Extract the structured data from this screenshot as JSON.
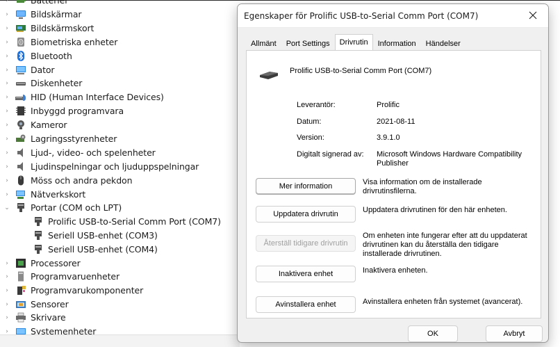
{
  "tree": {
    "items": [
      {
        "label": "Batterier",
        "icon": "battery-icon",
        "chevron": "›"
      },
      {
        "label": "Bildskärmar",
        "icon": "monitor-icon",
        "chevron": "›"
      },
      {
        "label": "Bildskärmskort",
        "icon": "display-adapter-icon",
        "chevron": "›"
      },
      {
        "label": "Biometriska enheter",
        "icon": "fingerprint-icon",
        "chevron": "›"
      },
      {
        "label": "Bluetooth",
        "icon": "bluetooth-icon",
        "chevron": "›"
      },
      {
        "label": "Dator",
        "icon": "computer-icon",
        "chevron": "›"
      },
      {
        "label": "Diskenheter",
        "icon": "disk-drive-icon",
        "chevron": "›"
      },
      {
        "label": "HID (Human Interface Devices)",
        "icon": "hid-icon",
        "chevron": "›"
      },
      {
        "label": "Inbyggd programvara",
        "icon": "firmware-icon",
        "chevron": "›"
      },
      {
        "label": "Kameror",
        "icon": "camera-icon",
        "chevron": "›"
      },
      {
        "label": "Lagringsstyrenheter",
        "icon": "storage-controller-icon",
        "chevron": "›"
      },
      {
        "label": "Ljud-, video- och spelenheter",
        "icon": "speaker-icon",
        "chevron": "›"
      },
      {
        "label": "Ljudinspelningar och ljuduppspelningar",
        "icon": "audio-io-icon",
        "chevron": "›"
      },
      {
        "label": "Möss och andra pekdon",
        "icon": "mouse-icon",
        "chevron": "›"
      },
      {
        "label": "Nätverkskort",
        "icon": "network-adapter-icon",
        "chevron": "›"
      },
      {
        "label": "Portar (COM och LPT)",
        "icon": "port-icon",
        "chevron": "⌄"
      },
      {
        "label": "Prolific USB-to-Serial Comm Port (COM7)",
        "icon": "port-icon",
        "child": true
      },
      {
        "label": "Seriell USB-enhet (COM3)",
        "icon": "port-icon",
        "child": true
      },
      {
        "label": "Seriell USB-enhet (COM4)",
        "icon": "port-icon",
        "child": true
      },
      {
        "label": "Processorer",
        "icon": "processor-icon",
        "chevron": "›"
      },
      {
        "label": "Programvaruenheter",
        "icon": "software-device-icon",
        "chevron": "›"
      },
      {
        "label": "Programvarukomponenter",
        "icon": "software-component-icon",
        "chevron": "›"
      },
      {
        "label": "Sensorer",
        "icon": "sensor-icon",
        "chevron": "›"
      },
      {
        "label": "Skrivare",
        "icon": "printer-icon",
        "chevron": "›"
      },
      {
        "label": "Systemenheter",
        "icon": "system-device-icon",
        "chevron": "›"
      }
    ]
  },
  "dialog": {
    "title": "Egenskaper för Prolific USB-to-Serial Comm Port (COM7)",
    "close_icon": "close-icon",
    "tabs": [
      "Allmänt",
      "Port Settings",
      "Drivrutin",
      "Information",
      "Händelser"
    ],
    "active_tab": "Drivrutin",
    "device_name": "Prolific USB-to-Serial Comm Port (COM7)",
    "device_icon": "usb-serial-cable-icon",
    "info": {
      "provider_label": "Leverantör:",
      "provider_value": "Prolific",
      "date_label": "Datum:",
      "date_value": "2021-08-11",
      "version_label": "Version:",
      "version_value": "3.9.1.0",
      "signer_label": "Digitalt signerad av:",
      "signer_value": "Microsoft Windows Hardware Compatibility Publisher"
    },
    "actions": [
      {
        "label": "Mer information",
        "desc": "Visa information om de installerade drivrutinsfilerna.",
        "enabled": true
      },
      {
        "label": "Uppdatera drivrutin",
        "desc": "Uppdatera drivrutinen för den här enheten.",
        "enabled": true
      },
      {
        "label": "Återställ tidigare drivrutin",
        "desc": "Om enheten inte fungerar efter att du uppdaterat drivrutinen kan du återställa den tidigare installerade drivrutinen.",
        "enabled": false
      },
      {
        "label": "Inaktivera enhet",
        "desc": "Inaktivera enheten.",
        "enabled": true
      },
      {
        "label": "Avinstallera enhet",
        "desc": "Avinstallera enheten från systemet (avancerat).",
        "enabled": true
      }
    ],
    "ok_label": "OK",
    "cancel_label": "Avbryt"
  }
}
